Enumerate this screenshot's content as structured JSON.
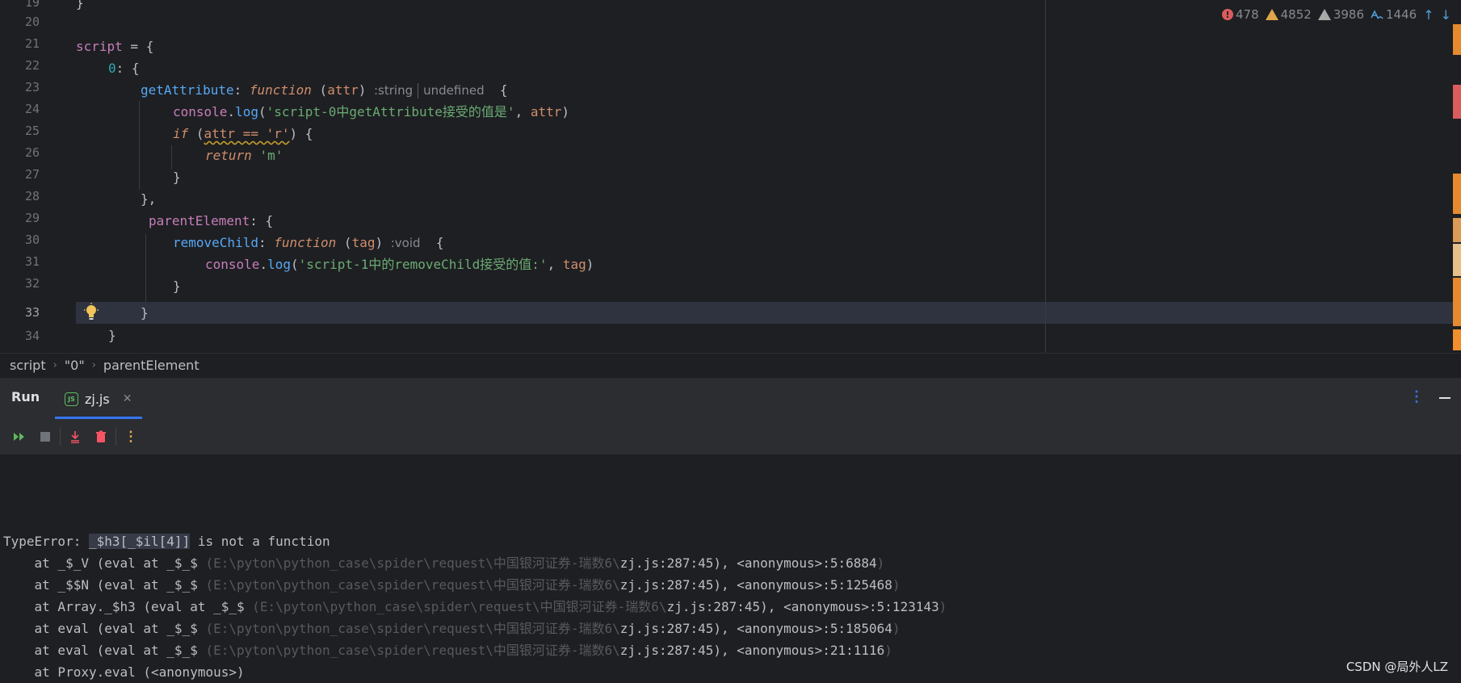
{
  "editor": {
    "line_numbers": [
      "19",
      "20",
      "21",
      "22",
      "23",
      "24",
      "25",
      "26",
      "27",
      "28",
      "29",
      "30",
      "31",
      "32",
      "33",
      "34"
    ],
    "current_line": "33",
    "lines": {
      "l19_brace": "}",
      "l21_script": "script",
      "l21_rest": " = {",
      "l22_num": "0",
      "l22_rest": ": {",
      "l23_prop": "getAttribute",
      "l23_colon": ": ",
      "l23_fn": "function",
      "l23_open": " (",
      "l23_param": "attr",
      "l23_close": ")",
      "l23_hint_type1": ":string",
      "l23_hint_type2": "undefined",
      "l23_brace": "  {",
      "l24_console": "console",
      "l24_dot": ".",
      "l24_log": "log",
      "l24_open": "(",
      "l24_str": "'script-0中getAttribute接受的值是'",
      "l24_comma": ", ",
      "l24_param": "attr",
      "l24_close": ")",
      "l25_if": "if",
      "l25_open": " (",
      "l25_cond": "attr == 'r'",
      "l25_close": ") {",
      "l26_return": "return",
      "l26_str": "'m'",
      "l27_brace": "}",
      "l28_brace": "},",
      "l29_prop": "parentElement",
      "l29_rest": ": {",
      "l30_prop": "removeChild",
      "l30_colon": ": ",
      "l30_fn": "function",
      "l30_open": " (",
      "l30_param": "tag",
      "l30_close": ")",
      "l30_hint": ":void",
      "l30_brace": "  {",
      "l31_console": "console",
      "l31_dot": ".",
      "l31_log": "log",
      "l31_open": "(",
      "l31_str": "'script-1中的removeChild接受的值:'",
      "l31_comma": ", ",
      "l31_param": "tag",
      "l31_close": ")",
      "l32_brace": "}",
      "l33_brace": "}",
      "l34_brace": "}"
    }
  },
  "inspections": {
    "errors": "478",
    "warnings": "4852",
    "weak_warnings": "3986",
    "typos": "1446"
  },
  "breadcrumb": [
    "script",
    "\"0\"",
    "parentElement"
  ],
  "run_panel": {
    "title": "Run",
    "tab_label": "zj.js",
    "tab_icon_text": "JS"
  },
  "console": {
    "error_prefix": "TypeError: ",
    "error_expr": "_$h3[_$il[4]]",
    "error_suffix": " is not a function",
    "stack": [
      {
        "pre": "    at _$_V (eval at _$_$ ",
        "path": "(E:\\pyton\\python_case\\spider\\request\\中国银河证券-瑞数6\\",
        "file": "zj.js:287:45), <anonymous>:5:6884",
        "end": ")"
      },
      {
        "pre": "    at _$$N (eval at _$_$ ",
        "path": "(E:\\pyton\\python_case\\spider\\request\\中国银河证券-瑞数6\\",
        "file": "zj.js:287:45), <anonymous>:5:125468",
        "end": ")"
      },
      {
        "pre": "    at Array._$h3 (eval at _$_$ ",
        "path": "(E:\\pyton\\python_case\\spider\\request\\中国银河证券-瑞数6\\",
        "file": "zj.js:287:45), <anonymous>:5:123143",
        "end": ")"
      },
      {
        "pre": "    at eval (eval at _$_$ ",
        "path": "(E:\\pyton\\python_case\\spider\\request\\中国银河证券-瑞数6\\",
        "file": "zj.js:287:45), <anonymous>:5:185064",
        "end": ")"
      },
      {
        "pre": "    at eval (eval at _$_$ ",
        "path": "(E:\\pyton\\python_case\\spider\\request\\中国银河证券-瑞数6\\",
        "file": "zj.js:287:45), <anonymous>:21:1116",
        "end": ")"
      }
    ],
    "proxy_line": "    at Proxy.eval (<anonymous>)"
  },
  "watermark": "CSDN @局外人LZ",
  "colors": {
    "accent": "#3574f0",
    "error": "#db5c5c",
    "warning": "#e0a54b"
  },
  "icons": [
    "lightbulb-icon",
    "error-icon",
    "warning-icon",
    "weak-warning-icon",
    "typo-icon",
    "arrow-up-icon",
    "arrow-down-icon",
    "js-file-icon",
    "close-icon",
    "more-vert-icon",
    "minimize-icon",
    "rerun-icon",
    "stop-icon",
    "scroll-to-end-icon",
    "trash-icon"
  ]
}
